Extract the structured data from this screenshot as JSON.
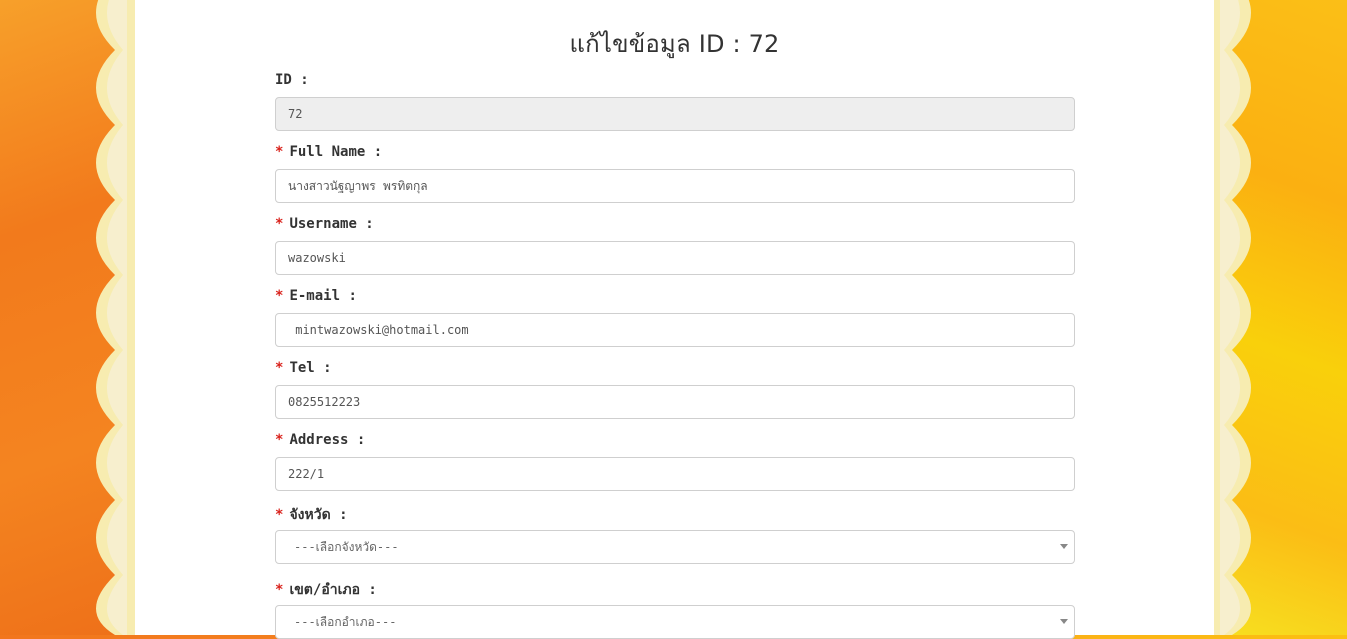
{
  "page": {
    "title": "แก้ไขข้อมูล ID : 72"
  },
  "form": {
    "required_mark": "*",
    "fields": [
      {
        "label": "ID :",
        "value": "72",
        "required": false,
        "disabled": true
      },
      {
        "label": "Full Name :",
        "value": "นางสาวนัฐญาพร พรทิตกุล",
        "required": true
      },
      {
        "label": "Username :",
        "value": "wazowski",
        "required": true
      },
      {
        "label": "E-mail :",
        "value": " mintwazowski@hotmail.com",
        "required": true
      },
      {
        "label": "Tel :",
        "value": "0825512223",
        "required": true
      },
      {
        "label": "Address :",
        "value": "222/1",
        "required": true
      }
    ],
    "selects": [
      {
        "label": "จังหวัด :",
        "selected": "---เลือกจังหวัด---",
        "required": true
      },
      {
        "label": "เขต/อำเภอ :",
        "selected": "---เลือกอำเภอ---",
        "required": true
      }
    ]
  },
  "colors": {
    "required": "#d9221c",
    "disabled_bg": "#eeeeee",
    "border": "#cfcfcf",
    "bg_orange": "#f27a1c",
    "bg_yellow": "#fbbd15",
    "scallop_cream": "#f7ecb0"
  }
}
